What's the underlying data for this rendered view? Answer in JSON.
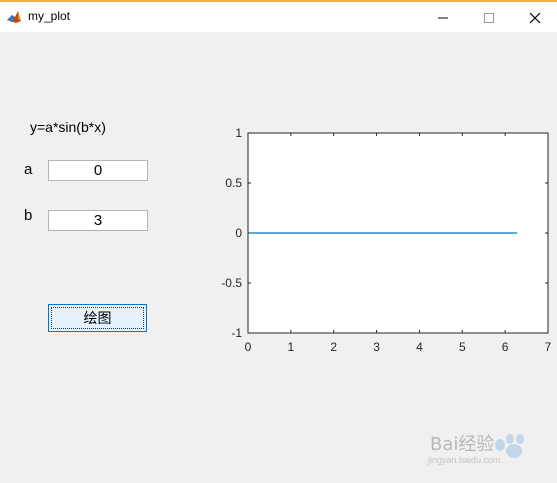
{
  "window": {
    "title": "my_plot",
    "controls": {
      "minimize": "minimize",
      "maximize": "maximize",
      "close": "close"
    }
  },
  "form": {
    "formula": "y=a*sin(b*x)",
    "a_label": "a",
    "a_value": "0",
    "b_label": "b",
    "b_value": "3",
    "plot_button": "绘图"
  },
  "chart_data": {
    "type": "line",
    "xlim": [
      0,
      7
    ],
    "ylim": [
      -1,
      1
    ],
    "xticks": [
      0,
      1,
      2,
      3,
      4,
      5,
      6,
      7
    ],
    "yticks": [
      -1,
      -0.5,
      0,
      0.5,
      1
    ],
    "xtick_labels": [
      "0",
      "1",
      "2",
      "3",
      "4",
      "5",
      "6",
      "7"
    ],
    "ytick_labels": [
      "-1",
      "-0.5",
      "0",
      "0.5",
      "1"
    ],
    "series": [
      {
        "x": [
          0,
          6.28
        ],
        "y": [
          0,
          0
        ],
        "color": "#0072bd"
      }
    ],
    "grid": false
  },
  "watermark": {
    "brand": "Bai经验",
    "sub": "jingyan.baidu.com"
  }
}
